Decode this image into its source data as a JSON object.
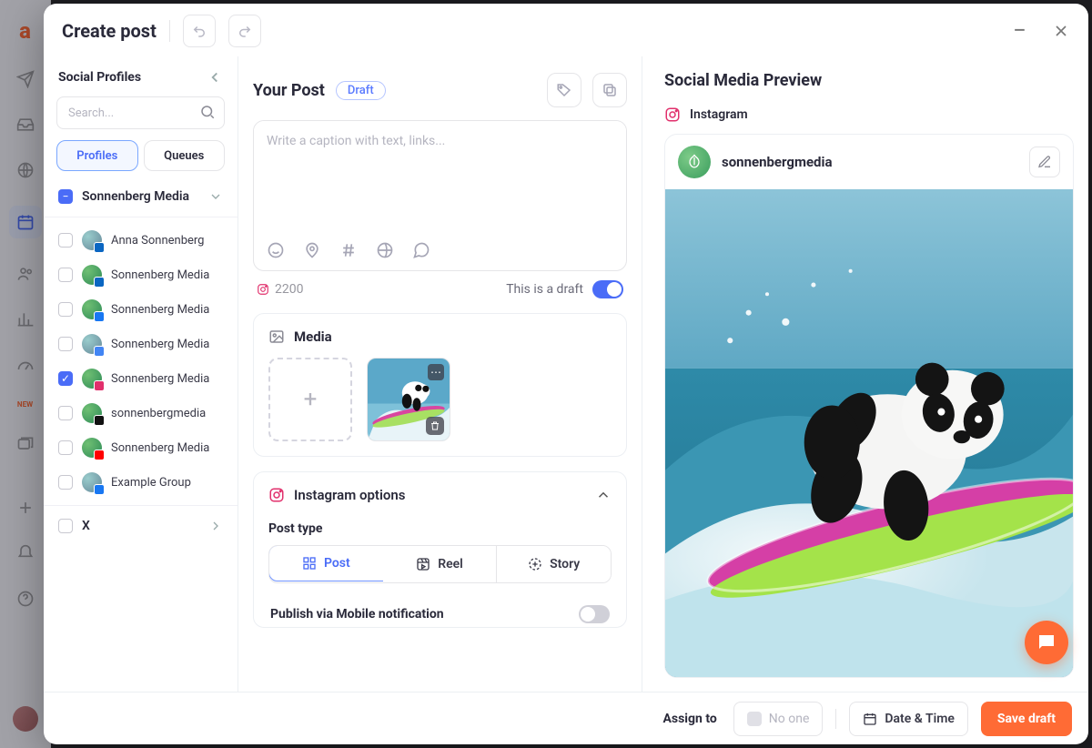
{
  "modal": {
    "title": "Create post"
  },
  "sidebar": {
    "heading": "Social Profiles",
    "search_placeholder": "Search...",
    "tabs": {
      "profiles": "Profiles",
      "queues": "Queues"
    },
    "workspace": "Sonnenberg Media",
    "profiles": [
      {
        "label": "Anna Sonnenberg",
        "network": "linkedin",
        "checked": false,
        "avatar": "person"
      },
      {
        "label": "Sonnenberg Media",
        "network": "linkedin",
        "checked": false,
        "avatar": "leaf"
      },
      {
        "label": "Sonnenberg Media",
        "network": "facebook",
        "checked": false,
        "avatar": "leaf"
      },
      {
        "label": "Sonnenberg Media",
        "network": "gmb",
        "checked": false,
        "avatar": "person"
      },
      {
        "label": "Sonnenberg Media",
        "network": "instagram",
        "checked": true,
        "avatar": "leaf"
      },
      {
        "label": "sonnenbergmedia",
        "network": "tiktok",
        "checked": false,
        "avatar": "leaf"
      },
      {
        "label": "Sonnenberg Media",
        "network": "youtube",
        "checked": false,
        "avatar": "leaf"
      },
      {
        "label": "Example Group",
        "network": "facebook",
        "checked": false,
        "avatar": "person"
      }
    ],
    "x_label": "X"
  },
  "composer": {
    "title": "Your Post",
    "draft_pill": "Draft",
    "placeholder": "Write a caption with text, links...",
    "char_count": "2200",
    "draft_label": "This is a draft"
  },
  "media": {
    "title": "Media"
  },
  "instagram_options": {
    "title": "Instagram options",
    "post_type_label": "Post type",
    "post": "Post",
    "reel": "Reel",
    "story": "Story",
    "mobile_pub_label": "Publish via Mobile notification"
  },
  "preview": {
    "title": "Social Media Preview",
    "network_label": "Instagram",
    "username": "sonnenbergmedia"
  },
  "footer": {
    "assign_label": "Assign to",
    "noone": "No one",
    "datetime": "Date & Time",
    "save": "Save draft"
  },
  "icons": {
    "minus": "−",
    "new": "NEW"
  },
  "network_colors": {
    "linkedin": "#0a66c2",
    "facebook": "#1877f2",
    "instagram": "#e1306c",
    "tiktok": "#111111",
    "youtube": "#ff0000",
    "gmb": "#4285f4"
  }
}
